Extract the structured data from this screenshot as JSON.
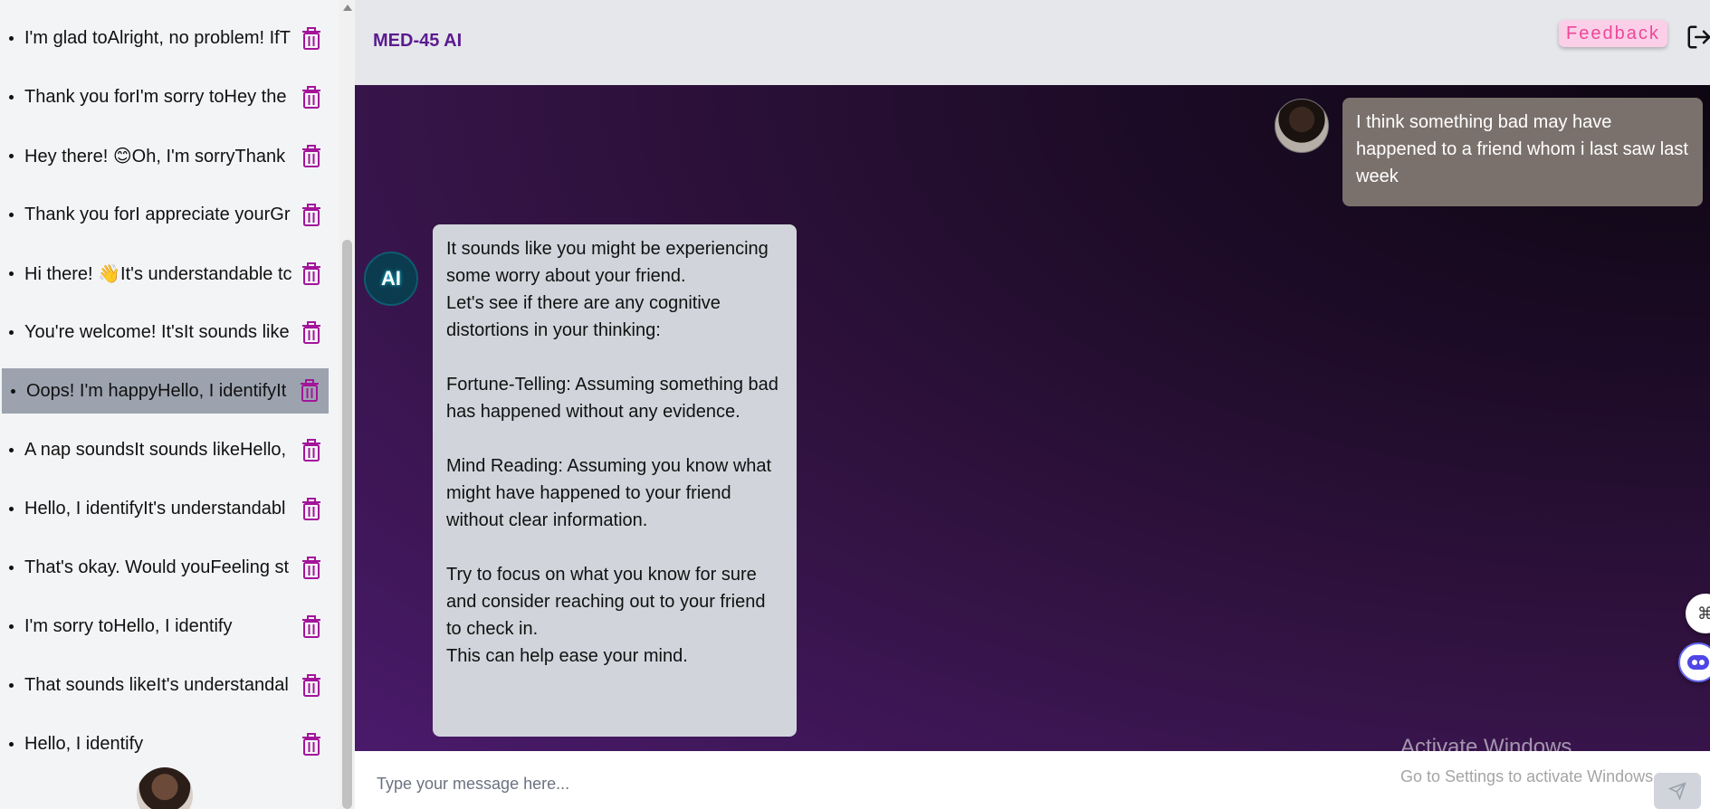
{
  "sidebar": {
    "items": [
      {
        "label": "I'm glad toAlright, no problem! IfT",
        "active": false
      },
      {
        "label": "Thank you forI'm sorry toHey the",
        "active": false
      },
      {
        "label": "Hey there! 😊Oh, I'm sorryThank",
        "active": false
      },
      {
        "label": "Thank you forI appreciate yourGr",
        "active": false
      },
      {
        "label": "Hi there! 👋It's understandable tc",
        "active": false
      },
      {
        "label": "You're welcome! It'sIt sounds like",
        "active": false
      },
      {
        "label": "Oops! I'm happyHello, I identifyIt",
        "active": true
      },
      {
        "label": "A nap soundsIt sounds likeHello,",
        "active": false
      },
      {
        "label": "Hello, I identifyIt's understandabl",
        "active": false
      },
      {
        "label": "That's okay. Would youFeeling st",
        "active": false
      },
      {
        "label": "I'm sorry toHello, I identify",
        "active": false
      },
      {
        "label": "That sounds likeIt's understandal",
        "active": false
      },
      {
        "label": "Hello, I identify",
        "active": false
      }
    ],
    "accent_color": "#a3149a"
  },
  "header": {
    "brand": "MED-45 AI",
    "feedback_label": "Feedback"
  },
  "chat": {
    "messages": [
      {
        "role": "user",
        "text": "I think something bad may have happened to a friend whom i last saw last week"
      },
      {
        "role": "assistant",
        "avatar_text": "AI",
        "text": "It sounds like you might be experiencing some worry about your friend.\nLet's see if there are any cognitive distortions in your thinking:\n\nFortune-Telling: Assuming something bad has happened without any evidence.\n\nMind Reading: Assuming you know what might have happened to your friend without clear information.\n\nTry to focus on what you know for sure and consider reaching out to your friend to check in.\nThis can help ease your mind."
      }
    ]
  },
  "input": {
    "placeholder": "Type your message here...",
    "value": ""
  },
  "watermark": {
    "title": "Activate Windows",
    "subtitle": "Go to Settings to activate Windows."
  }
}
